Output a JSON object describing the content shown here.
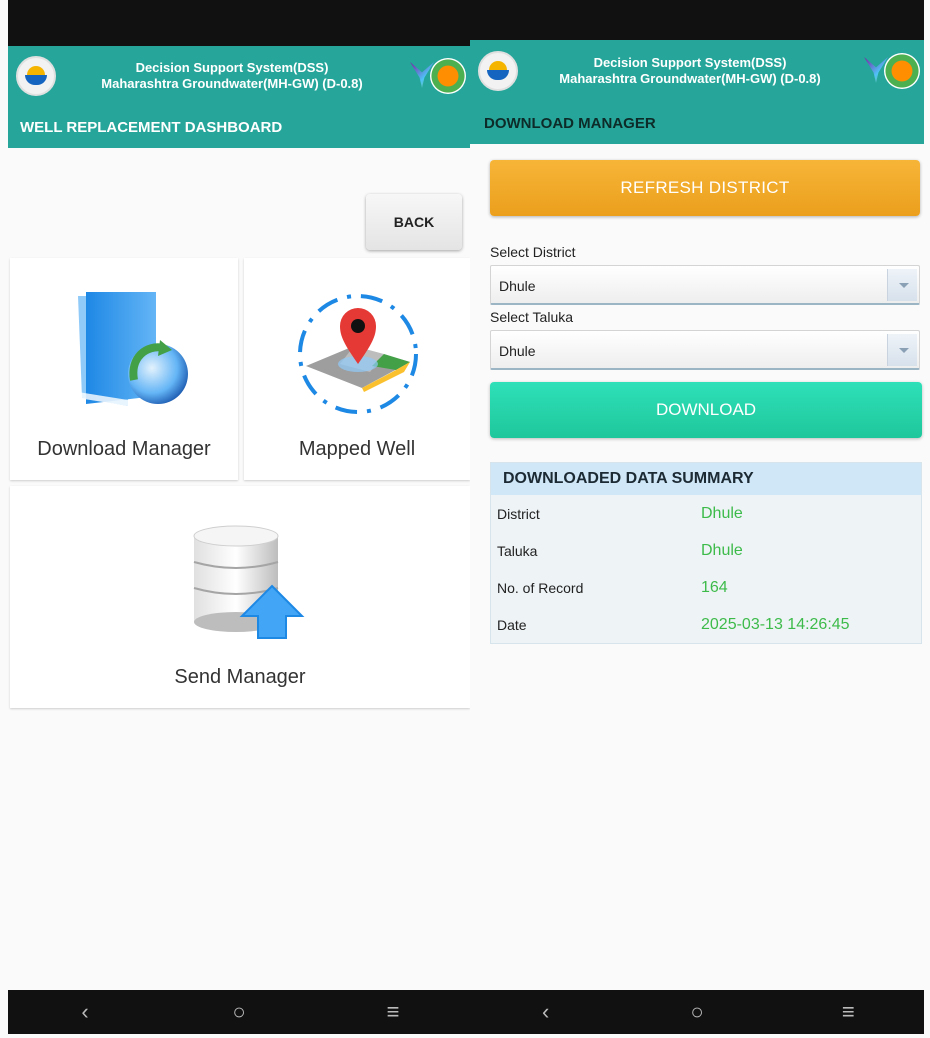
{
  "app": {
    "title_line1": "Decision Support System(DSS)",
    "title_line2": "Maharashtra Groundwater(MH-GW) (D-0.8)"
  },
  "dashboard": {
    "page_title": "WELL REPLACEMENT DASHBOARD",
    "back_label": "BACK",
    "tiles": [
      {
        "label": "Download Manager",
        "icon": "folder-globe-icon"
      },
      {
        "label": "Mapped Well",
        "icon": "map-pin-icon"
      },
      {
        "label": "Send Manager",
        "icon": "database-upload-icon"
      }
    ]
  },
  "download_manager": {
    "page_title": "DOWNLOAD MANAGER",
    "refresh_label": "REFRESH DISTRICT",
    "district_label": "Select District",
    "district_value": "Dhule",
    "taluka_label": "Select Taluka",
    "taluka_value": "Dhule",
    "download_label": "DOWNLOAD",
    "summary": {
      "heading": "DOWNLOADED DATA SUMMARY",
      "rows": [
        {
          "key": "District",
          "value": "Dhule"
        },
        {
          "key": "Taluka",
          "value": "Dhule"
        },
        {
          "key": "No. of Record",
          "value": "164"
        },
        {
          "key": "Date",
          "value": "2025-03-13 14:26:45"
        }
      ]
    }
  },
  "navbar": {
    "back": "‹",
    "home": "○",
    "menu": "≡"
  },
  "colors": {
    "header_teal": "#26a69a",
    "refresh_orange": "#eb9f1c",
    "download_green": "#1fc79c",
    "value_green": "#3dbb4a"
  }
}
